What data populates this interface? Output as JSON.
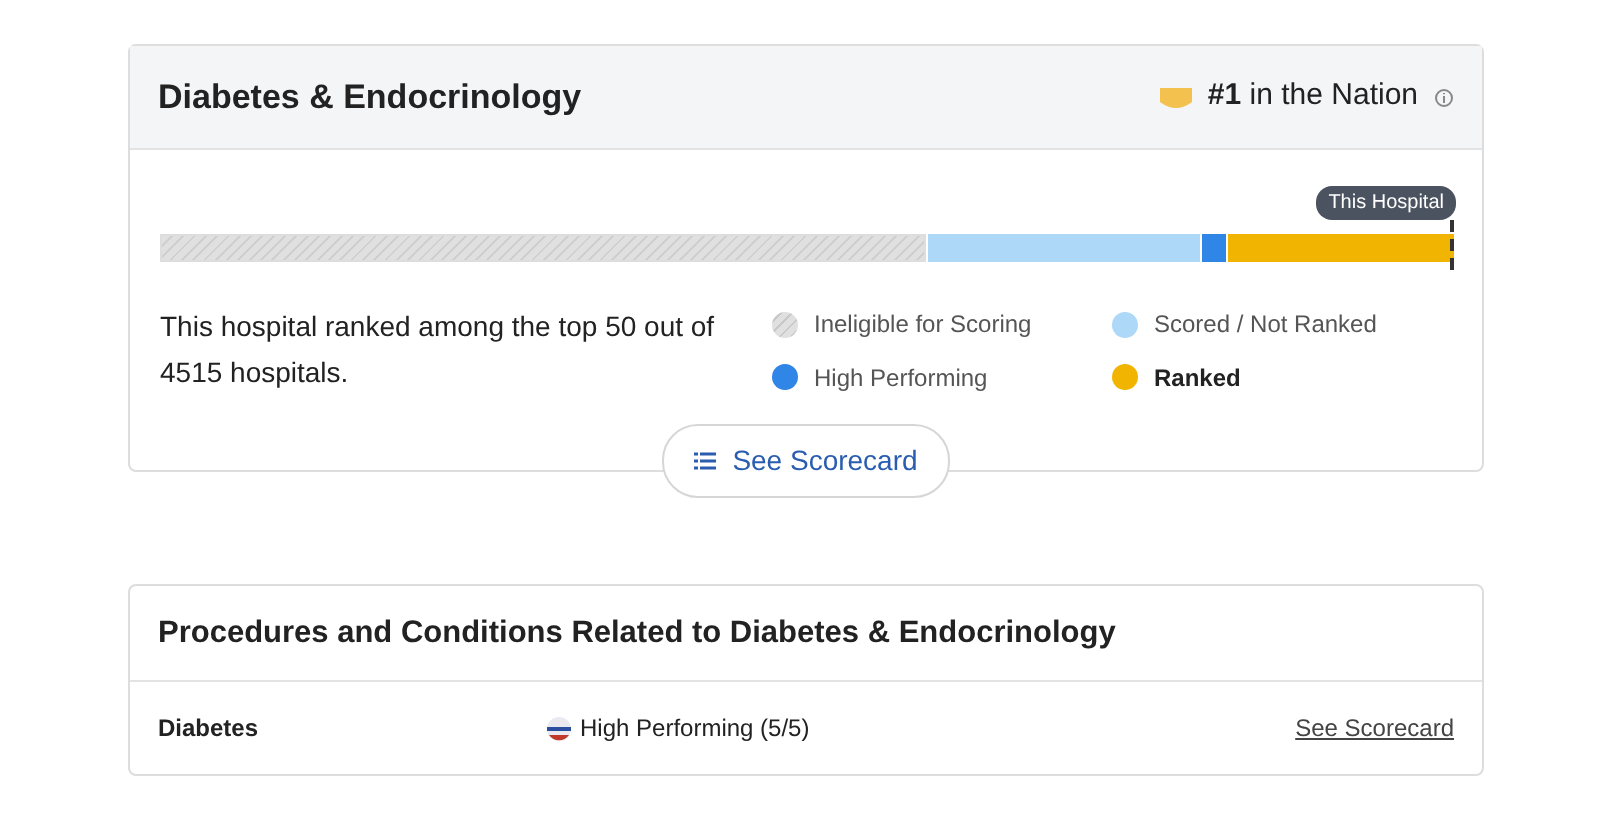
{
  "specialty_card": {
    "title": "Diabetes & Endocrinology",
    "rank_badge": "#1",
    "rank_text": "in the Nation",
    "marker_label": "This Hospital",
    "segments": [
      {
        "kind": "ineligible",
        "color": "#e0e0e0"
      },
      {
        "kind": "scored",
        "color": "#aed8f7"
      },
      {
        "kind": "high",
        "color": "#2f86e6"
      },
      {
        "kind": "ranked",
        "color": "#f1b400"
      }
    ],
    "summary": "This hospital ranked among the top 50 out of 4515 hospitals.",
    "legend": [
      {
        "label": "Ineligible for Scoring",
        "kind": "hatched",
        "color": "#e0e0e0",
        "bold": false
      },
      {
        "label": "Scored / Not Ranked",
        "kind": "solid",
        "color": "#aed8f7",
        "bold": false
      },
      {
        "label": "High Performing",
        "kind": "solid",
        "color": "#2f86e6",
        "bold": false
      },
      {
        "label": "Ranked",
        "kind": "solid",
        "color": "#f1b400",
        "bold": true
      }
    ],
    "button": "See Scorecard"
  },
  "procedures_card": {
    "title": "Procedures and Conditions Related to Diabetes & Endocrinology",
    "rows": [
      {
        "name": "Diabetes",
        "rating": "High Performing (5/5)",
        "link": "See Scorecard"
      }
    ]
  }
}
